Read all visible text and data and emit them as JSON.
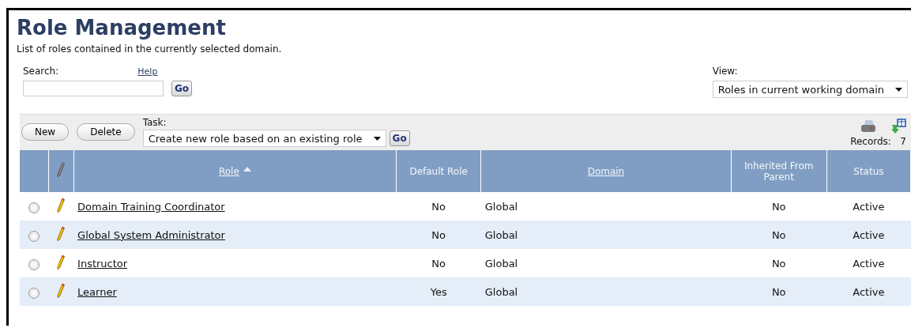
{
  "title": "Role Management",
  "description": "List of roles contained in the currently selected domain.",
  "search": {
    "label": "Search:",
    "help": "Help",
    "go": "Go"
  },
  "view": {
    "label": "View:",
    "value": "Roles in current working domain"
  },
  "toolbar": {
    "buttons": [
      "New",
      "Delete"
    ],
    "task_label": "Task:",
    "task_value": "Create new role based on an existing role",
    "go": "Go",
    "records_label": "Records:",
    "records": "7"
  },
  "columns": [
    {
      "kind": "select"
    },
    {
      "kind": "edit"
    },
    {
      "kind": "text",
      "label": "Role",
      "link": true,
      "sorted": true
    },
    {
      "kind": "text",
      "label": "Default Role",
      "link": false
    },
    {
      "kind": "text",
      "label": "Domain",
      "link": true
    },
    {
      "kind": "text",
      "label": "Inherited From Parent",
      "link": false
    },
    {
      "kind": "text",
      "label": "Status",
      "link": false
    }
  ],
  "rows": [
    {
      "selected": false,
      "role": "Domain Training Coordinator",
      "default_role": "No",
      "domain": "Global",
      "inherited": "No",
      "status": "Active"
    },
    {
      "selected": false,
      "role": "Global System Administrator",
      "default_role": "No",
      "domain": "Global",
      "inherited": "No",
      "status": "Active"
    },
    {
      "selected": false,
      "role": "Instructor",
      "default_role": "No",
      "domain": "Global",
      "inherited": "No",
      "status": "Active"
    },
    {
      "selected": false,
      "role": "Learner",
      "default_role": "Yes",
      "domain": "Global",
      "inherited": "No",
      "status": "Active"
    }
  ]
}
